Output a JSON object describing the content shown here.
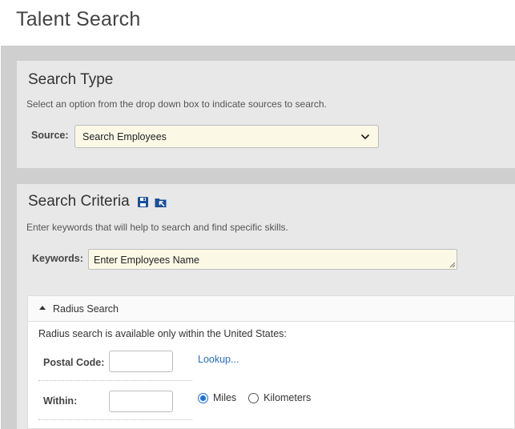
{
  "page": {
    "title": "Talent Search"
  },
  "search_type": {
    "title": "Search Type",
    "description": "Select an option from the drop down box to indicate sources to search.",
    "source_label": "Source:",
    "source_value": "Search Employees"
  },
  "search_criteria": {
    "title": "Search Criteria",
    "description": "Enter keywords that will help to search and find specific skills.",
    "keywords_label": "Keywords:",
    "keywords_value": "Enter Employees Name",
    "icons": [
      "save-icon",
      "folder-open-icon"
    ]
  },
  "radius_search": {
    "header": "Radius Search",
    "note": "Radius search is available only within the United States:",
    "postal_label": "Postal Code:",
    "postal_value": "",
    "lookup_label": "Lookup...",
    "within_label": "Within:",
    "within_value": "",
    "units": [
      {
        "label": "Miles",
        "checked": true
      },
      {
        "label": "Kilometers",
        "checked": false
      }
    ]
  },
  "colors": {
    "accent": "#1f6fe0",
    "link": "#2a6ebb",
    "input_bg": "#fbf9e6",
    "icon_blue": "#1a4f9c"
  }
}
